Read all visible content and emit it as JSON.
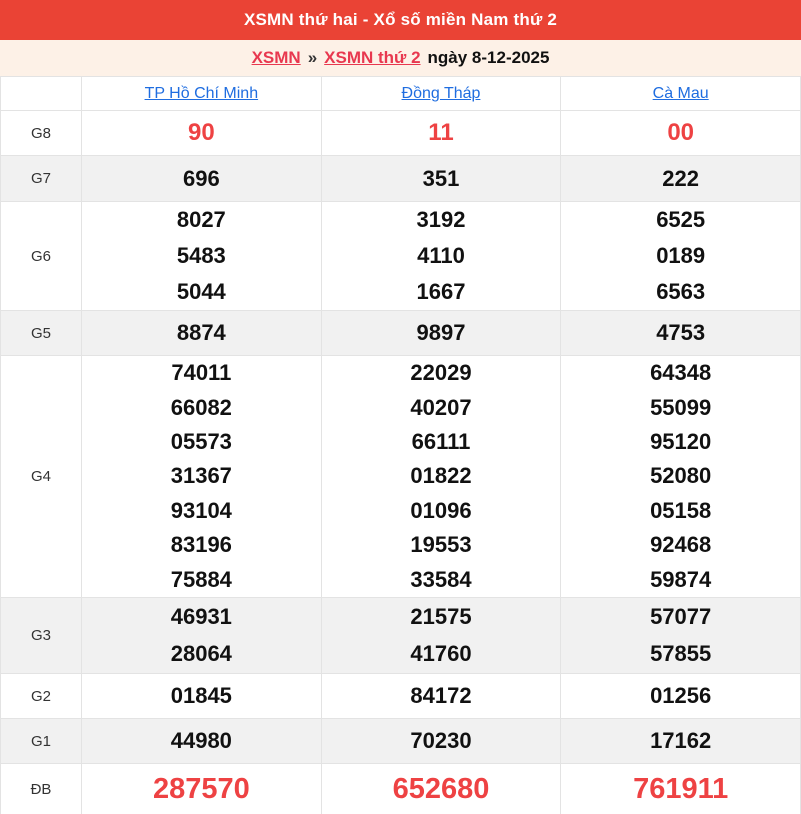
{
  "header": {
    "title": "XSMN thứ hai - Xổ số miền Nam thứ 2",
    "bar_color": "#ea4335"
  },
  "breadcrumb": {
    "link1": "XSMN",
    "separator": "»",
    "link2": "XSMN thứ 2",
    "date": "ngày 8-12-2025"
  },
  "table": {
    "columns": [
      "TP Hồ Chí Minh",
      "Đồng Tháp",
      "Cà Mau"
    ],
    "rows": [
      {
        "label": "G8",
        "style": "g8",
        "cells": [
          [
            "90"
          ],
          [
            "11"
          ],
          [
            "00"
          ]
        ]
      },
      {
        "label": "G7",
        "style": "",
        "cells": [
          [
            "696"
          ],
          [
            "351"
          ],
          [
            "222"
          ]
        ]
      },
      {
        "label": "G6",
        "style": "",
        "cells": [
          [
            "8027",
            "5483",
            "5044"
          ],
          [
            "3192",
            "4110",
            "1667"
          ],
          [
            "6525",
            "0189",
            "6563"
          ]
        ]
      },
      {
        "label": "G5",
        "style": "",
        "cells": [
          [
            "8874"
          ],
          [
            "9897"
          ],
          [
            "4753"
          ]
        ]
      },
      {
        "label": "G4",
        "style": "",
        "cells": [
          [
            "74011",
            "66082",
            "05573",
            "31367",
            "93104",
            "83196",
            "75884"
          ],
          [
            "22029",
            "40207",
            "66111",
            "01822",
            "01096",
            "19553",
            "33584"
          ],
          [
            "64348",
            "55099",
            "95120",
            "52080",
            "05158",
            "92468",
            "59874"
          ]
        ]
      },
      {
        "label": "G3",
        "style": "",
        "cells": [
          [
            "46931",
            "28064"
          ],
          [
            "21575",
            "41760"
          ],
          [
            "57077",
            "57855"
          ]
        ]
      },
      {
        "label": "G2",
        "style": "",
        "cells": [
          [
            "01845"
          ],
          [
            "84172"
          ],
          [
            "01256"
          ]
        ]
      },
      {
        "label": "G1",
        "style": "",
        "cells": [
          [
            "44980"
          ],
          [
            "70230"
          ],
          [
            "17162"
          ]
        ]
      },
      {
        "label": "ĐB",
        "style": "db",
        "cells": [
          [
            "287570"
          ],
          [
            "652680"
          ],
          [
            "761911"
          ]
        ]
      }
    ]
  },
  "colors": {
    "accent_red": "#ea4335",
    "link_red": "#e8384f",
    "link_blue": "#1f6de0",
    "number_red": "#ee4243",
    "shaded_row": "#f1f1f1",
    "breadcrumb_bg": "#fdf1e7"
  }
}
